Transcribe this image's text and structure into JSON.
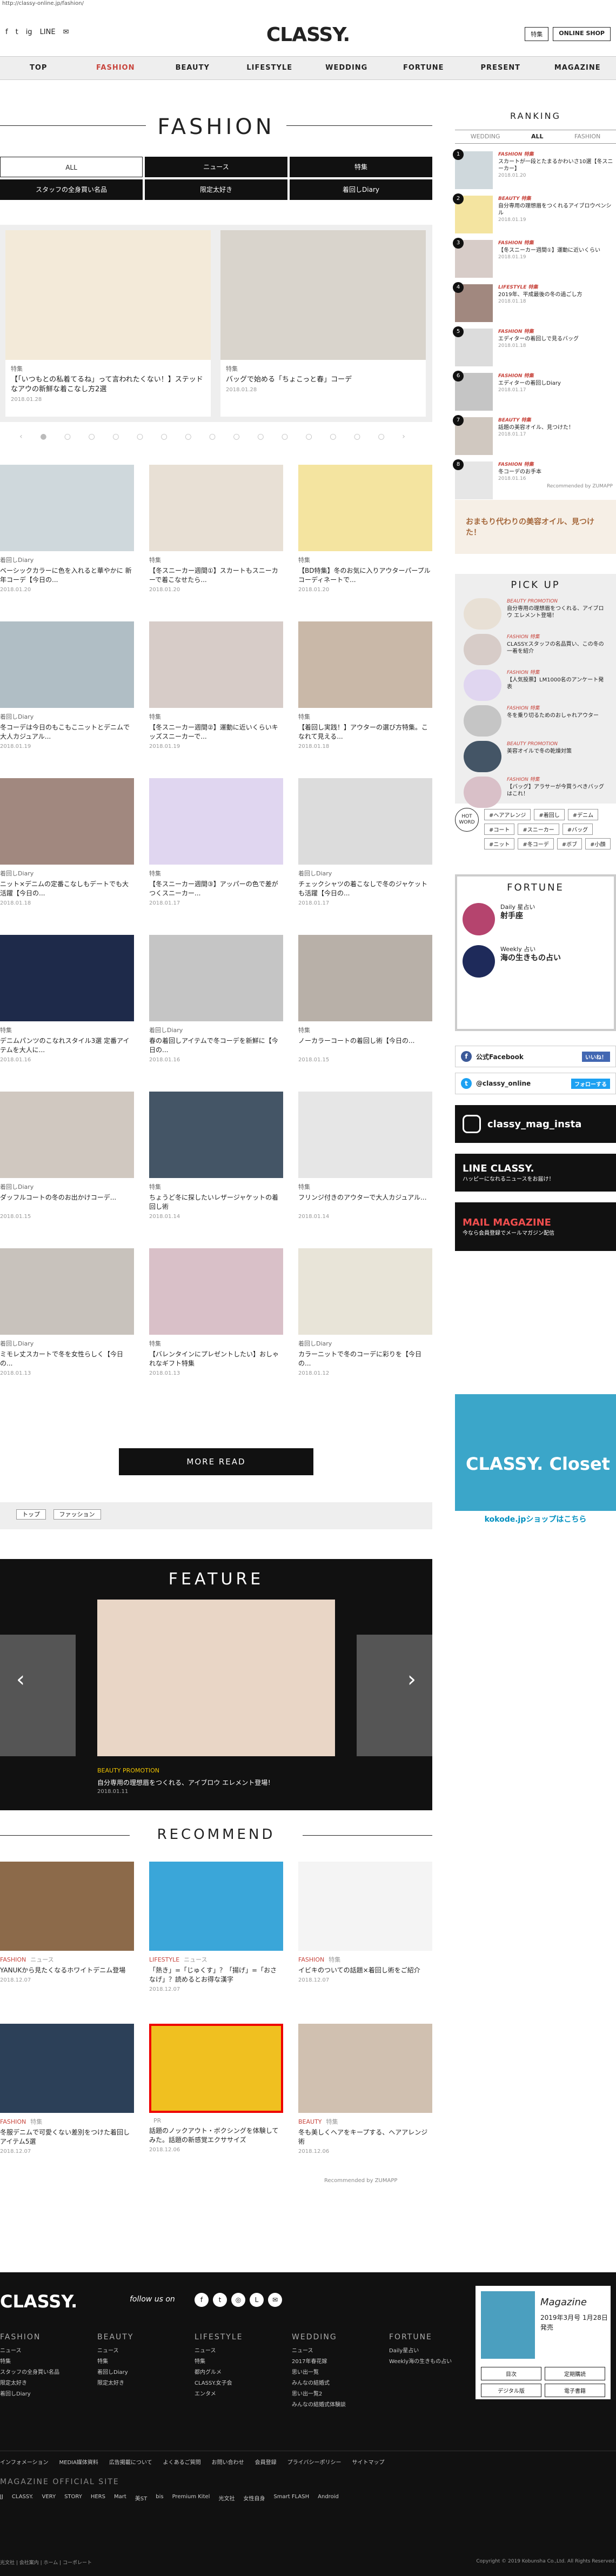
{
  "url": "http://classy-online.jp/fashion/",
  "header": {
    "logo": "CLASSY.",
    "social": [
      "f",
      "t",
      "ig",
      "LINE",
      "✉"
    ],
    "btn_feature": "特集",
    "btn_shop": "ONLINE SHOP"
  },
  "nav": [
    "TOP",
    "FASHION",
    "BEAUTY",
    "LIFESTYLE",
    "WEDDING",
    "FORTUNE",
    "PRESENT",
    "MAGAZINE"
  ],
  "page_title": "FASHION",
  "tabs": [
    "ALL",
    "ニュース",
    "特集",
    "スタッフの全身買い名品",
    "限定太好き",
    "着回しDiary"
  ],
  "slides": [
    {
      "cat": "特集",
      "title": "【「いつもとの私着てるね」って言われたくない！】ステッドなアウの新鮮な着こなし方2選",
      "date": "2018.01.28"
    },
    {
      "cat": "特集",
      "title": "バッグで始める「ちょこっと春」コーデ",
      "date": "2018.01.28"
    }
  ],
  "dots": "‹ ● ○ ○ ○ ○ ○ ○ ○ ○ ○ ○ ○ ○ ○ ○ ›",
  "cards": [
    {
      "cat": "着回しDiary",
      "title": "ベーシックカラーに色を入れると華やかに 新年コーデ【今日の...",
      "date": "2018.01.20"
    },
    {
      "cat": "特集",
      "title": "【冬スニーカー週間①】スカートもスニーカーで着こなせたら...",
      "date": "2018.01.20"
    },
    {
      "cat": "特集",
      "title": "【BD特集】冬のお気に入りアウターパープルコーディネートで...",
      "date": "2018.01.20"
    },
    {
      "cat": "着回しDiary",
      "title": "冬コーデは今日のもこもこニットとデニムで大人カジュアル...",
      "date": "2018.01.19"
    },
    {
      "cat": "特集",
      "title": "【冬スニーカー週間②】運動に近いくらいキッズスニーカーで...",
      "date": "2018.01.19"
    },
    {
      "cat": "特集",
      "title": "【着回し実践！】アウターの選び方特集。こなれて見える...",
      "date": "2018.01.18"
    },
    {
      "cat": "着回しDiary",
      "title": "ニット×デニムの定番こなしもデートでも大活躍【今日の...",
      "date": "2018.01.18"
    },
    {
      "cat": "特集",
      "title": "【冬スニーカー週間③】アッパーの色で差がつくスニーカー...",
      "date": "2018.01.17"
    },
    {
      "cat": "着回しDiary",
      "title": "チェックシャツの着こなしで冬のジャケットも活躍【今日の...",
      "date": "2018.01.17"
    },
    {
      "cat": "特集",
      "title": "デニムパンツのこなれスタイル3選 定番アイテムを大人に...",
      "date": "2018.01.16"
    },
    {
      "cat": "着回しDiary",
      "title": "春の着回しアイテムで冬コーデを新鮮に【今日の...",
      "date": "2018.01.16"
    },
    {
      "cat": "特集",
      "title": "ノーカラーコートの着回し術【今日の...",
      "date": "2018.01.15"
    },
    {
      "cat": "着回しDiary",
      "title": "ダッフルコートの冬のお出かけコーデ...",
      "date": "2018.01.15"
    },
    {
      "cat": "特集",
      "title": "ちょうど冬に探したいレザージャケットの着回し術",
      "date": "2018.01.14"
    },
    {
      "cat": "特集",
      "title": "フリンジ付きのアウターで大人カジュアル...",
      "date": "2018.01.14"
    },
    {
      "cat": "着回しDiary",
      "title": "ミモレ丈スカートで冬を女性らしく【今日の...",
      "date": "2018.01.13"
    },
    {
      "cat": "特集",
      "title": "【バレンタインにプレゼントしたい】おしゃれなギフト特集",
      "date": "2018.01.13"
    },
    {
      "cat": "着回しDiary",
      "title": "カラーニットで冬のコーデに彩りを【今日の...",
      "date": "2018.01.12"
    }
  ],
  "more": "MORE READ",
  "breadcrumb": [
    "トップ",
    "ファッション"
  ],
  "feature": {
    "title": "FEATURE",
    "cat": "BEAUTY",
    "cat2": "PROMOTION",
    "ttl": "自分専用の理想眉をつくれる、アイブロウ エレメント登場！",
    "date": "2018.01.11"
  },
  "recommend_title": "RECOMMEND",
  "recs": [
    {
      "cat": "FASHION",
      "sub": "ニュース",
      "title": "YANUKから見たくなるホワイトデニム登場",
      "date": "2018.12.07"
    },
    {
      "cat": "LIFESTYLE",
      "sub": "ニュース",
      "title": "「熱き」=「じゅくす」？「揚げ」=「おさなげ」？読めるとお得な漢字",
      "date": "2018.12.07"
    },
    {
      "cat": "FASHION",
      "sub": "特集",
      "title": "イビキのついての話題×着回し術をご紹介",
      "date": "2018.12.07"
    },
    {
      "cat": "FASHION",
      "sub": "特集",
      "title": "冬服デニムで可愛くない差別をつけた着回しアイテム5選",
      "date": "2018.12.07"
    },
    {
      "cat": "",
      "sub": "PR",
      "title": "話題のノックアウト・ボクシングを体験してみた。話題の新感覚エクササイズ",
      "date": "2018.12.06"
    },
    {
      "cat": "BEAUTY",
      "sub": "特集",
      "title": "冬も美しくヘアをキープする、ヘアアレンジ術",
      "date": "2018.12.06"
    }
  ],
  "powered": "Recommended by ZUMAPP",
  "ranking": {
    "title": "RANKING",
    "tabs": [
      "WEDDING",
      "ALL",
      "FASHION"
    ],
    "items": [
      {
        "n": "1",
        "cat": "FASHION 特集",
        "title": "スカートが一段とたまるかわいさ10選【冬スニーカー】",
        "date": "2018.01.20"
      },
      {
        "n": "2",
        "cat": "BEAUTY 特集",
        "title": "自分専用の理想眉をつくれるアイブロウペンシル",
        "date": "2018.01.19"
      },
      {
        "n": "3",
        "cat": "FASHION 特集",
        "title": "【冬スニーカー週間①】運動に近いくらい",
        "date": "2018.01.19"
      },
      {
        "n": "4",
        "cat": "LIFESTYLE 特集",
        "title": "2019年、平成最後の冬の過ごし方",
        "date": "2018.01.18"
      },
      {
        "n": "5",
        "cat": "FASHION 特集",
        "title": "エディターの着回しで見るバッグ",
        "date": "2018.01.18"
      },
      {
        "n": "6",
        "cat": "FASHION 特集",
        "title": "エディターの着回しDiary",
        "date": "2018.01.17"
      },
      {
        "n": "7",
        "cat": "BEAUTY 特集",
        "title": "話題の美容オイル、見つけた！",
        "date": "2018.01.17"
      },
      {
        "n": "8",
        "cat": "FASHION 特集",
        "title": "冬コーデのお手本",
        "date": "2018.01.16"
      }
    ]
  },
  "ad1": "おまもり代わりの美容オイル、見つけた！",
  "pickup": {
    "title": "PICK UP",
    "items": [
      {
        "cat": "BEAUTY PROMOTION",
        "title": "自分専用の理想眉をつくれる、アイブロウ エレメント登場！"
      },
      {
        "cat": "FASHION 特集",
        "title": "CLASSY.スタッフの名品買い、この冬の一着を紹介"
      },
      {
        "cat": "FASHION 特集",
        "title": "【人気投票】LM1000名のアンケート発表"
      },
      {
        "cat": "FASHION 特集",
        "title": "冬を乗り切るためのおしゃれアウター"
      },
      {
        "cat": "BEAUTY PROMOTION",
        "title": "美容オイルで冬の乾燥対策"
      },
      {
        "cat": "FASHION 特集",
        "title": "【バッグ】アラサーが今買うべきバッグはこれ！"
      }
    ]
  },
  "hotword": {
    "badge": "HOT WORD",
    "tags": [
      "#ヘアアレンジ",
      "#着回し",
      "#デニム",
      "#コート",
      "#スニーカー",
      "#バッグ",
      "#ニット",
      "#冬コーデ",
      "#ボブ",
      "#小顔"
    ]
  },
  "fortune": {
    "title": "FORTUNE",
    "daily": "Daily 星占い",
    "daily_sub": "射手座",
    "weekly": "Weekly 占い",
    "weekly_sub": "海の生きもの占い"
  },
  "fb": "公式Facebook",
  "fb_like": "いいね！",
  "tw": "@classy_online",
  "tw_follow": "フォローする",
  "insta": "classy_mag_insta",
  "line": "LINE CLASSY.",
  "line_sub": "ハッピーになれるニュースをお届け！",
  "mail": "MAIL MAGAZINE",
  "mail_sub": "今なら会員登録でメールマガジン配信",
  "closet": "CLASSY. Closet",
  "closet_cta": "kokode.jpショップはこちら",
  "footer": {
    "logo": "CLASSY.",
    "follow": "follow us on",
    "cols": [
      {
        "h": "FASHION",
        "items": [
          "ニュース",
          "特集",
          "スタッフの全身買い名品",
          "限定太好き",
          "着回しDiary"
        ]
      },
      {
        "h": "BEAUTY",
        "items": [
          "ニュース",
          "特集",
          "着回しDiary",
          "限定太好き"
        ]
      },
      {
        "h": "LIFESTYLE",
        "items": [
          "ニュース",
          "特集",
          "都内グルメ",
          "CLASSY.女子会",
          "エンタメ"
        ]
      },
      {
        "h": "WEDDING",
        "items": [
          "ニュース",
          "2017年春花嫁",
          "思い出一覧",
          "みんなの結婚式",
          "思い出一覧2",
          "みんなの結婚式体験談"
        ]
      },
      {
        "h": "FORTUNE",
        "items": [
          "Daily星占い",
          "Weekly海の生きもの占い"
        ]
      }
    ],
    "mag_title": "Magazine",
    "mag_date": "2019年3月号 1月28日発売",
    "mag_btns": [
      "目次",
      "定期購読",
      "デジタル版",
      "電子書籍"
    ],
    "links": [
      "インフォメーション",
      "MEDIA媒体資料",
      "広告掲載について",
      "よくあるご質問",
      "お問い合わせ",
      "会員登録",
      "プライバシーポリシー",
      "サイトマップ"
    ],
    "official": "MAGAZINE OFFICIAL SITE",
    "official_links": [
      "JJ",
      "CLASSY.",
      "VERY",
      "STORY",
      "HERS",
      "Mart",
      "美ST",
      "bis",
      "Premium Kitel",
      "光文社",
      "女性自身",
      "Smart FLASH",
      "Android"
    ],
    "bottom_left": "光文社 | 会社案内 | ホーム | コーポレート",
    "copyright": "Copyright © 2019 Kobunsha Co.,Ltd. All Rights Reserved."
  }
}
